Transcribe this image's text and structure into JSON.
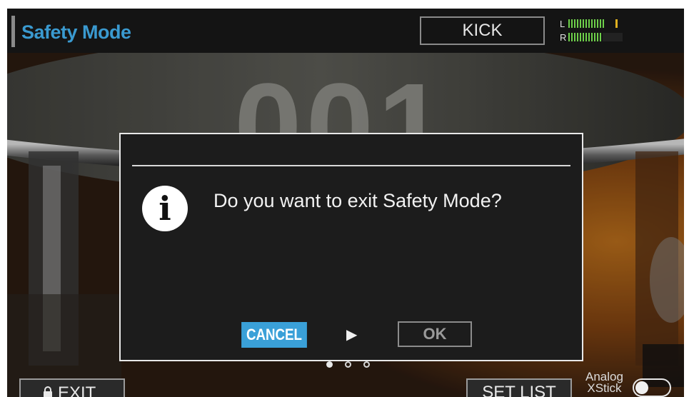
{
  "header": {
    "title": "Safety Mode",
    "instrument": "KICK",
    "meter": {
      "left_label": "L",
      "right_label": "R"
    }
  },
  "kit": {
    "number": "001"
  },
  "dialog": {
    "message": "Do you want to exit Safety Mode?",
    "icon": "info-icon",
    "cancel_label": "CANCEL",
    "ok_label": "OK",
    "selected": "CANCEL"
  },
  "footer": {
    "exit_label": "EXIT",
    "set_list_label": "SET LIST",
    "xstick_label_1": "Analog",
    "xstick_label_2": "XStick",
    "xstick_on": false
  },
  "page_dots": {
    "count": 3,
    "active": 0
  },
  "colors": {
    "accent": "#3a9ad0",
    "cancel_bg": "#3aa0d8",
    "dialog_bg": "#1c1c1c",
    "header_bg": "#141414"
  }
}
